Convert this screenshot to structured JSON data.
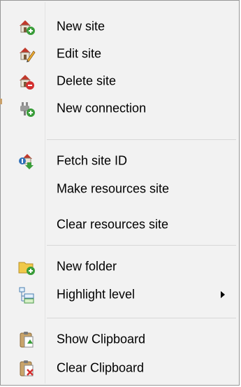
{
  "menu": {
    "items": [
      {
        "label": "New site",
        "icon": "new-site-icon"
      },
      {
        "label": "Edit site",
        "icon": "edit-site-icon"
      },
      {
        "label": "Delete site",
        "icon": "delete-site-icon"
      },
      {
        "label": "New connection",
        "icon": "new-connection-icon"
      },
      {
        "label": "Fetch site ID",
        "icon": "fetch-site-id-icon"
      },
      {
        "label": "Make resources site",
        "icon": ""
      },
      {
        "label": "Clear resources site",
        "icon": ""
      },
      {
        "label": "New folder",
        "icon": "new-folder-icon"
      },
      {
        "label": "Highlight level",
        "icon": "highlight-level-icon",
        "submenu": true
      },
      {
        "label": "Show Clipboard",
        "icon": "show-clipboard-icon"
      },
      {
        "label": "Clear Clipboard",
        "icon": "clear-clipboard-icon"
      }
    ]
  },
  "colors": {
    "menu_background": "#f2f2f2",
    "menu_border": "#979797",
    "separator": "#d7d7d7",
    "house_red": "#c0392b",
    "plus_green": "#3a9d3a",
    "minus_red": "#d32f2f",
    "folder_yellow": "#f0c94a"
  }
}
